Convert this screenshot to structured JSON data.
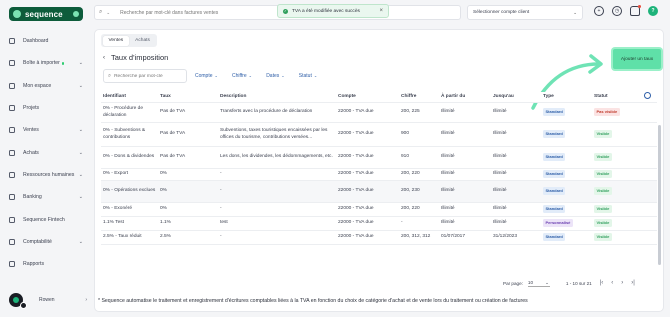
{
  "brand": {
    "name": "sequence"
  },
  "sidebar": {
    "items": [
      {
        "label": "Dashboard",
        "chevron": false
      },
      {
        "label": "Boîte à importer",
        "chevron": true,
        "dot": true
      },
      {
        "label": "Mon espace",
        "chevron": true
      },
      {
        "label": "Projets",
        "chevron": false
      },
      {
        "label": "Ventes",
        "chevron": true
      },
      {
        "label": "Achats",
        "chevron": true
      },
      {
        "label": "Ressources humaines",
        "chevron": true
      },
      {
        "label": "Banking",
        "chevron": true
      },
      {
        "label": "Sequence Fintech",
        "chevron": false
      },
      {
        "label": "Comptabilité",
        "chevron": true
      },
      {
        "label": "Rapports",
        "chevron": false
      }
    ],
    "user": {
      "name": "Rowen"
    }
  },
  "topbar": {
    "search_placeholder": "Recherche par mot-clé dans factures ventes",
    "toast": "TVA a été modifiée avec succès",
    "company_select": "Sélectionner compte client"
  },
  "tabs": [
    {
      "label": "Ventes",
      "active": true
    },
    {
      "label": "Achats",
      "active": false
    }
  ],
  "page": {
    "title": "Taux d'imposition",
    "search_placeholder": "Recherche par mot-clé",
    "filters": [
      "Compte",
      "Chiffre",
      "Dates",
      "Statut"
    ],
    "add_button": "Ajouter un taux"
  },
  "table": {
    "headers": [
      "Identifiant",
      "Taux",
      "Description",
      "Compte",
      "Chiffre",
      "À partir du",
      "Jusqu'au",
      "Type",
      "Statut"
    ],
    "rows": [
      {
        "id": "0% - Procédure de déclaration",
        "rate": "Pas de TVA",
        "desc": "Transferts avec la procédure de déclaration",
        "account": "22000 - TVA due",
        "code": "200, 225",
        "from": "Illimité",
        "to": "Illimité",
        "type": "Standard",
        "status": "Pas visible",
        "shaded": false
      },
      {
        "id": "0% - Subventions & contributions",
        "rate": "Pas de TVA",
        "desc": "Subventions, taxes touristiques encaissées par les offices du tourisme, contributions versées...",
        "account": "22000 - TVA due",
        "code": "900",
        "from": "Illimité",
        "to": "Illimité",
        "type": "Standard",
        "status": "Visible",
        "shaded": false
      },
      {
        "id": "0% - Dons & dividendes",
        "rate": "Pas de TVA",
        "desc": "Les dons, les dividendes, les dédommagements, etc.",
        "account": "22000 - TVA due",
        "code": "910",
        "from": "Illimité",
        "to": "Illimité",
        "type": "Standard",
        "status": "Visible",
        "shaded": false
      },
      {
        "id": "0% - Export",
        "rate": "0%",
        "desc": "-",
        "account": "22000 - TVA due",
        "code": "200, 220",
        "from": "Illimité",
        "to": "Illimité",
        "type": "Standard",
        "status": "Visible",
        "shaded": false
      },
      {
        "id": "0% - Opérations exclues",
        "rate": "0%",
        "desc": "-",
        "account": "22000 - TVA due",
        "code": "200, 230",
        "from": "Illimité",
        "to": "Illimité",
        "type": "Standard",
        "status": "Visible",
        "shaded": true
      },
      {
        "id": "0% - Exonéré",
        "rate": "0%",
        "desc": "-",
        "account": "22000 - TVA due",
        "code": "200, 220",
        "from": "Illimité",
        "to": "Illimité",
        "type": "Standard",
        "status": "Visible",
        "shaded": false
      },
      {
        "id": "1.1% Test",
        "rate": "1.1%",
        "desc": "test",
        "account": "22000 - TVA due",
        "code": "-",
        "from": "Illimité",
        "to": "Illimité",
        "type": "Personnalisé",
        "status": "Visible",
        "shaded": false
      },
      {
        "id": "2.5% - Taux réduit",
        "rate": "2.5%",
        "desc": "-",
        "account": "22000 - TVA due",
        "code": "200, 312, 312",
        "from": "01/07/2017",
        "to": "31/12/2023",
        "type": "Standard",
        "status": "Visible",
        "shaded": false
      }
    ]
  },
  "pagination": {
    "per_page_label": "Par page:",
    "per_page": "10",
    "range": "1 - 10 sur 21"
  },
  "footnote": "* Sequence automatise le traitement et enregistrement d'écritures comptables liées à la TVA en fonction du choix de catégorie d'achat et de vente lors du traitement ou création de factures"
}
